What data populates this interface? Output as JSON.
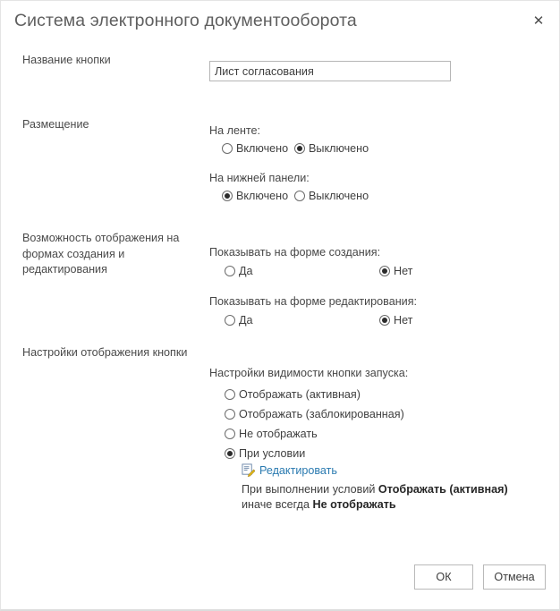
{
  "dialog": {
    "title": "Система электронного документооборота",
    "close_icon": "close-icon",
    "close_label": "✕"
  },
  "sections": {
    "button_name": {
      "label": "Название кнопки",
      "input_value": "Лист согласования",
      "input_placeholder": ""
    },
    "placement": {
      "label": "Размещение",
      "ribbon": {
        "sub_label": "На ленте:",
        "option_on": "Включено",
        "option_off": "Выключено",
        "selected": "Выключено"
      },
      "bottom_panel": {
        "sub_label": "На нижней панели:",
        "option_on": "Включено",
        "option_off": "Выключено",
        "selected": "Включено"
      }
    },
    "forms_visibility": {
      "label": "Возможность отображения на формах создания и редактирования",
      "create_form": {
        "sub_label": "Показывать на форме создания:",
        "option_yes": "Да",
        "option_no": "Нет",
        "selected": "Нет"
      },
      "edit_form": {
        "sub_label": "Показывать на форме редактирования:",
        "option_yes": "Да",
        "option_no": "Нет",
        "selected": "Нет"
      }
    },
    "button_display": {
      "label": "Настройки отображения кнопки",
      "visibility": {
        "sub_label": "Настройки видимости кнопки запуска:",
        "options": [
          "Отображать (активная)",
          "Отображать (заблокированная)",
          "Не отображать",
          "При условии"
        ],
        "selected": "При условии"
      },
      "edit_link": {
        "icon": "edit-document-icon",
        "label": "Редактировать"
      },
      "condition_summary": {
        "prefix": "При выполнении условий ",
        "then_value": "Отображать (активная)",
        "middle": "иначе всегда  ",
        "else_value": "Не отображать"
      }
    }
  },
  "footer": {
    "ok_label": "ОК",
    "cancel_label": "Отмена"
  },
  "colors": {
    "link": "#2a7ab0",
    "title_text": "#5f5f5f",
    "body_text": "#3f3f3f",
    "border": "#b5b5b5"
  }
}
